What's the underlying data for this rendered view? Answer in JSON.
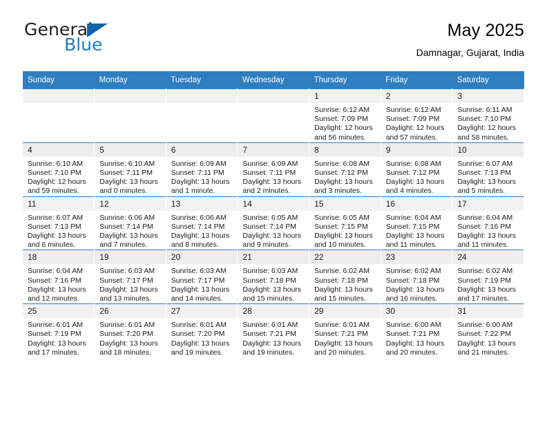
{
  "brand": {
    "name_part1": "General",
    "name_part2": "Blue",
    "logo_icon": "blue-triangle-mark"
  },
  "header": {
    "title": "May 2025",
    "subtitle": "Damnagar, Gujarat, India"
  },
  "colors": {
    "header_blue": "#2F7EC0",
    "brand_blue": "#1F7AC4",
    "daynum_band": "#F2F2F2",
    "text": "#1A1A1A"
  },
  "weekdays": [
    "Sunday",
    "Monday",
    "Tuesday",
    "Wednesday",
    "Thursday",
    "Friday",
    "Saturday"
  ],
  "labels": {
    "sunrise": "Sunrise:",
    "sunset": "Sunset:",
    "daylight": "Daylight:"
  },
  "weeks": [
    [
      {
        "day": "",
        "lines": []
      },
      {
        "day": "",
        "lines": []
      },
      {
        "day": "",
        "lines": []
      },
      {
        "day": "",
        "lines": []
      },
      {
        "day": "1",
        "lines": [
          "Sunrise: 6:12 AM",
          "Sunset: 7:09 PM",
          "Daylight: 12 hours",
          "and 56 minutes."
        ]
      },
      {
        "day": "2",
        "lines": [
          "Sunrise: 6:12 AM",
          "Sunset: 7:09 PM",
          "Daylight: 12 hours",
          "and 57 minutes."
        ]
      },
      {
        "day": "3",
        "lines": [
          "Sunrise: 6:11 AM",
          "Sunset: 7:10 PM",
          "Daylight: 12 hours",
          "and 58 minutes."
        ]
      }
    ],
    [
      {
        "day": "4",
        "lines": [
          "Sunrise: 6:10 AM",
          "Sunset: 7:10 PM",
          "Daylight: 12 hours",
          "and 59 minutes."
        ]
      },
      {
        "day": "5",
        "lines": [
          "Sunrise: 6:10 AM",
          "Sunset: 7:11 PM",
          "Daylight: 13 hours",
          "and 0 minutes."
        ]
      },
      {
        "day": "6",
        "lines": [
          "Sunrise: 6:09 AM",
          "Sunset: 7:11 PM",
          "Daylight: 13 hours",
          "and 1 minute."
        ]
      },
      {
        "day": "7",
        "lines": [
          "Sunrise: 6:09 AM",
          "Sunset: 7:11 PM",
          "Daylight: 13 hours",
          "and 2 minutes."
        ]
      },
      {
        "day": "8",
        "lines": [
          "Sunrise: 6:08 AM",
          "Sunset: 7:12 PM",
          "Daylight: 13 hours",
          "and 3 minutes."
        ]
      },
      {
        "day": "9",
        "lines": [
          "Sunrise: 6:08 AM",
          "Sunset: 7:12 PM",
          "Daylight: 13 hours",
          "and 4 minutes."
        ]
      },
      {
        "day": "10",
        "lines": [
          "Sunrise: 6:07 AM",
          "Sunset: 7:13 PM",
          "Daylight: 13 hours",
          "and 5 minutes."
        ]
      }
    ],
    [
      {
        "day": "11",
        "lines": [
          "Sunrise: 6:07 AM",
          "Sunset: 7:13 PM",
          "Daylight: 13 hours",
          "and 6 minutes."
        ]
      },
      {
        "day": "12",
        "lines": [
          "Sunrise: 6:06 AM",
          "Sunset: 7:14 PM",
          "Daylight: 13 hours",
          "and 7 minutes."
        ]
      },
      {
        "day": "13",
        "lines": [
          "Sunrise: 6:06 AM",
          "Sunset: 7:14 PM",
          "Daylight: 13 hours",
          "and 8 minutes."
        ]
      },
      {
        "day": "14",
        "lines": [
          "Sunrise: 6:05 AM",
          "Sunset: 7:14 PM",
          "Daylight: 13 hours",
          "and 9 minutes."
        ]
      },
      {
        "day": "15",
        "lines": [
          "Sunrise: 6:05 AM",
          "Sunset: 7:15 PM",
          "Daylight: 13 hours",
          "and 10 minutes."
        ]
      },
      {
        "day": "16",
        "lines": [
          "Sunrise: 6:04 AM",
          "Sunset: 7:15 PM",
          "Daylight: 13 hours",
          "and 11 minutes."
        ]
      },
      {
        "day": "17",
        "lines": [
          "Sunrise: 6:04 AM",
          "Sunset: 7:16 PM",
          "Daylight: 13 hours",
          "and 11 minutes."
        ]
      }
    ],
    [
      {
        "day": "18",
        "lines": [
          "Sunrise: 6:04 AM",
          "Sunset: 7:16 PM",
          "Daylight: 13 hours",
          "and 12 minutes."
        ]
      },
      {
        "day": "19",
        "lines": [
          "Sunrise: 6:03 AM",
          "Sunset: 7:17 PM",
          "Daylight: 13 hours",
          "and 13 minutes."
        ]
      },
      {
        "day": "20",
        "lines": [
          "Sunrise: 6:03 AM",
          "Sunset: 7:17 PM",
          "Daylight: 13 hours",
          "and 14 minutes."
        ]
      },
      {
        "day": "21",
        "lines": [
          "Sunrise: 6:03 AM",
          "Sunset: 7:18 PM",
          "Daylight: 13 hours",
          "and 15 minutes."
        ]
      },
      {
        "day": "22",
        "lines": [
          "Sunrise: 6:02 AM",
          "Sunset: 7:18 PM",
          "Daylight: 13 hours",
          "and 15 minutes."
        ]
      },
      {
        "day": "23",
        "lines": [
          "Sunrise: 6:02 AM",
          "Sunset: 7:18 PM",
          "Daylight: 13 hours",
          "and 16 minutes."
        ]
      },
      {
        "day": "24",
        "lines": [
          "Sunrise: 6:02 AM",
          "Sunset: 7:19 PM",
          "Daylight: 13 hours",
          "and 17 minutes."
        ]
      }
    ],
    [
      {
        "day": "25",
        "lines": [
          "Sunrise: 6:01 AM",
          "Sunset: 7:19 PM",
          "Daylight: 13 hours",
          "and 17 minutes."
        ]
      },
      {
        "day": "26",
        "lines": [
          "Sunrise: 6:01 AM",
          "Sunset: 7:20 PM",
          "Daylight: 13 hours",
          "and 18 minutes."
        ]
      },
      {
        "day": "27",
        "lines": [
          "Sunrise: 6:01 AM",
          "Sunset: 7:20 PM",
          "Daylight: 13 hours",
          "and 19 minutes."
        ]
      },
      {
        "day": "28",
        "lines": [
          "Sunrise: 6:01 AM",
          "Sunset: 7:21 PM",
          "Daylight: 13 hours",
          "and 19 minutes."
        ]
      },
      {
        "day": "29",
        "lines": [
          "Sunrise: 6:01 AM",
          "Sunset: 7:21 PM",
          "Daylight: 13 hours",
          "and 20 minutes."
        ]
      },
      {
        "day": "30",
        "lines": [
          "Sunrise: 6:00 AM",
          "Sunset: 7:21 PM",
          "Daylight: 13 hours",
          "and 20 minutes."
        ]
      },
      {
        "day": "31",
        "lines": [
          "Sunrise: 6:00 AM",
          "Sunset: 7:22 PM",
          "Daylight: 13 hours",
          "and 21 minutes."
        ]
      }
    ]
  ]
}
